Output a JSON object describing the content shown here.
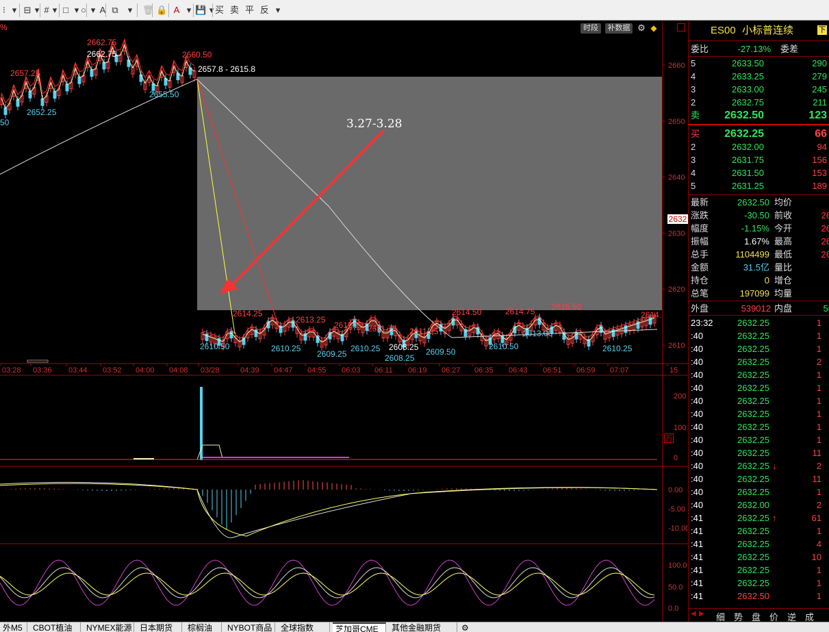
{
  "toolbar": {
    "items": [
      "⁝",
      "▾",
      "⊟",
      "▾",
      "#",
      "▾",
      "□",
      "▾",
      "○",
      "▾",
      "A",
      "⧉",
      "▾",
      "🗑",
      "🔒",
      "A",
      "▾",
      "💾",
      "▾",
      "买",
      "卖",
      "平",
      "反",
      "▾"
    ]
  },
  "chart": {
    "pct_label": "%",
    "btn_time": "时段",
    "btn_fill": "补数据",
    "annotation": "3.27-3.28",
    "range_label": "2657.8 - 2615.8",
    "current_price_tag": "2632",
    "indicator_box": "万",
    "price_labels": [
      {
        "t": "2662.75",
        "c": "red"
      },
      {
        "t": "2662.75",
        "c": "white"
      },
      {
        "t": "2657.25",
        "c": "red"
      },
      {
        "t": "2652.25",
        "c": "cyan"
      },
      {
        "t": "2655.50",
        "c": "cyan"
      },
      {
        "t": "2660.50",
        "c": "red"
      },
      {
        "t": "50",
        "c": "cyan"
      },
      {
        "t": "2614.25",
        "c": "red"
      },
      {
        "t": "2613.25",
        "c": "red"
      },
      {
        "t": "2612.25",
        "c": "red"
      },
      {
        "t": "2611.75",
        "c": "red"
      },
      {
        "t": "2611.25",
        "c": "red"
      },
      {
        "t": "2614.50",
        "c": "red"
      },
      {
        "t": "2614.75",
        "c": "red"
      },
      {
        "t": "2615.50",
        "c": "red"
      },
      {
        "t": "2614.",
        "c": "red"
      },
      {
        "t": "2610.50",
        "c": "cyan"
      },
      {
        "t": "2610.25",
        "c": "cyan"
      },
      {
        "t": "2609.25",
        "c": "cyan"
      },
      {
        "t": "2610.25",
        "c": "cyan"
      },
      {
        "t": "2608.25",
        "c": "white"
      },
      {
        "t": "2608.25",
        "c": "cyan"
      },
      {
        "t": "2609.50",
        "c": "cyan"
      },
      {
        "t": "2613.00",
        "c": "cyan"
      },
      {
        "t": "2610.50",
        "c": "cyan"
      },
      {
        "t": "2610.25",
        "c": "cyan"
      }
    ],
    "x_ticks": [
      "03:28",
      "03:36",
      "03:44",
      "03:52",
      "04:00",
      "04:08",
      "03/28",
      "04:39",
      "04:47",
      "04:55",
      "06:03",
      "06:11",
      "06:19",
      "06:27",
      "06:35",
      "06:43",
      "06:51",
      "06:59",
      "07:07",
      "15"
    ],
    "y_ticks": [
      "2660",
      "2650",
      "2640",
      "2630",
      "2620",
      "2610"
    ],
    "vol_ticks": [
      "200",
      "100",
      "0"
    ],
    "macd_ticks": [
      "0.00",
      "-5.00",
      "-10.00"
    ],
    "kdj_ticks": [
      "100.0",
      "50.0",
      "0.0"
    ]
  },
  "panel": {
    "symbol": "ES00",
    "name": "小标普连续",
    "badge": "下",
    "weibi_label": "委比",
    "weibi_value": "-27.13%",
    "weicha_label": "委差",
    "asks": [
      {
        "lvl": "5",
        "price": "2633.50",
        "vol": "290"
      },
      {
        "lvl": "4",
        "price": "2633.25",
        "vol": "279"
      },
      {
        "lvl": "3",
        "price": "2633.00",
        "vol": "245"
      },
      {
        "lvl": "2",
        "price": "2632.75",
        "vol": "211"
      },
      {
        "lvl": "卖",
        "price": "2632.50",
        "vol": "123"
      }
    ],
    "bids": [
      {
        "lvl": "买",
        "price": "2632.25",
        "vol": "66"
      },
      {
        "lvl": "2",
        "price": "2632.00",
        "vol": "94"
      },
      {
        "lvl": "3",
        "price": "2631.75",
        "vol": "156"
      },
      {
        "lvl": "4",
        "price": "2631.50",
        "vol": "153"
      },
      {
        "lvl": "5",
        "price": "2631.25",
        "vol": "189"
      }
    ],
    "stats": [
      {
        "l1": "最新",
        "v1": "2632.50",
        "c1": "g",
        "l2": "均价",
        "v2": ""
      },
      {
        "l1": "涨跌",
        "v1": "-30.50",
        "c1": "g",
        "l2": "前收",
        "v2": "26"
      },
      {
        "l1": "幅度",
        "v1": "-1.15%",
        "c1": "g",
        "l2": "今开",
        "v2": "26"
      },
      {
        "l1": "振幅",
        "v1": "1.67%",
        "c1": "w",
        "l2": "最高",
        "v2": "26"
      },
      {
        "l1": "总手",
        "v1": "1104499",
        "c1": "y",
        "l2": "最低",
        "v2": "26"
      },
      {
        "l1": "金额",
        "v1": "31.5亿",
        "c1": "c",
        "l2": "量比",
        "v2": ""
      },
      {
        "l1": "持仓",
        "v1": "0",
        "c1": "y",
        "l2": "增仓",
        "v2": ""
      },
      {
        "l1": "总笔",
        "v1": "197099",
        "c1": "y",
        "l2": "均量",
        "v2": ""
      }
    ],
    "waipan_label": "外盘",
    "waipan_value": "539012",
    "neipan_label": "内盘",
    "neipan_value": "5(",
    "ticks": [
      {
        "t": "23:32",
        "p": "2632.25",
        "a": "",
        "v": "1"
      },
      {
        "t": ":40",
        "p": "2632.25",
        "a": "",
        "v": "1"
      },
      {
        "t": ":40",
        "p": "2632.25",
        "a": "",
        "v": "1"
      },
      {
        "t": ":40",
        "p": "2632.25",
        "a": "",
        "v": "2"
      },
      {
        "t": ":40",
        "p": "2632.25",
        "a": "",
        "v": "1"
      },
      {
        "t": ":40",
        "p": "2632.25",
        "a": "",
        "v": "1"
      },
      {
        "t": ":40",
        "p": "2632.25",
        "a": "",
        "v": "1"
      },
      {
        "t": ":40",
        "p": "2632.25",
        "a": "",
        "v": "1"
      },
      {
        "t": ":40",
        "p": "2632.25",
        "a": "",
        "v": "1"
      },
      {
        "t": ":40",
        "p": "2632.25",
        "a": "",
        "v": "1"
      },
      {
        "t": ":40",
        "p": "2632.25",
        "a": "",
        "v": "11"
      },
      {
        "t": ":40",
        "p": "2632.25",
        "a": "↓",
        "v": "2"
      },
      {
        "t": ":40",
        "p": "2632.25",
        "a": "",
        "v": "11"
      },
      {
        "t": ":40",
        "p": "2632.25",
        "a": "",
        "v": "1"
      },
      {
        "t": ":40",
        "p": "2632.00",
        "a": "",
        "v": "2"
      },
      {
        "t": ":41",
        "p": "2632.25",
        "a": "↑",
        "v": "61"
      },
      {
        "t": ":41",
        "p": "2632.25",
        "a": "",
        "v": "1"
      },
      {
        "t": ":41",
        "p": "2632.25",
        "a": "",
        "v": "4"
      },
      {
        "t": ":41",
        "p": "2632.25",
        "a": "",
        "v": "10"
      },
      {
        "t": ":41",
        "p": "2632.25",
        "a": "",
        "v": "1"
      },
      {
        "t": ":41",
        "p": "2632.25",
        "a": "",
        "v": "1"
      },
      {
        "t": ":41",
        "p": "2632.50",
        "a": "",
        "v": "1"
      }
    ],
    "bottom_tabs": [
      "细",
      "势",
      "盘",
      "价",
      "逆",
      "成"
    ]
  },
  "bottom_tabs": [
    "外M5",
    "CBOT植油",
    "NYMEX能源",
    "日本期货",
    "棕榈油",
    "NYBOT商品",
    "全球指数",
    "芝加哥CME",
    "其他金融期货"
  ]
}
